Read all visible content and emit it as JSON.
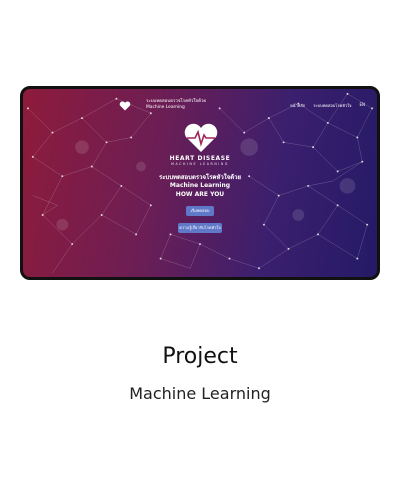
{
  "colors": {
    "gradient_start": "#8e1b3b",
    "gradient_mid": "#6b1e55",
    "gradient_end": "#241a66",
    "button": "#5f79c8",
    "frame_border": "#111111"
  },
  "nav": {
    "brand_line1": "ระบบทดสอบตรวจโรคหัวใจด้วย",
    "brand_line2": "Machine Learning",
    "links": [
      "หน้าหลัก",
      "ระบบทดสอบโรคหัวใจ",
      "EN"
    ],
    "logo_icon": "heart-icon"
  },
  "hero": {
    "logo_icon": "heart-pulse-icon",
    "title": "HEART DISEASE",
    "subtitle": "MACHINE LEARNING",
    "thai_heading": "ระบบทดสอบตรวจโรคหัวใจด้วย",
    "ml_heading": "Machine Learning",
    "tagline": "HOW ARE YOU",
    "button_primary": "เริ่มทดสอบ",
    "button_secondary": "ความรู้เกี่ยวกับโรคหัวใจ"
  },
  "caption": {
    "title": "Project",
    "subtitle": "Machine Learning"
  }
}
